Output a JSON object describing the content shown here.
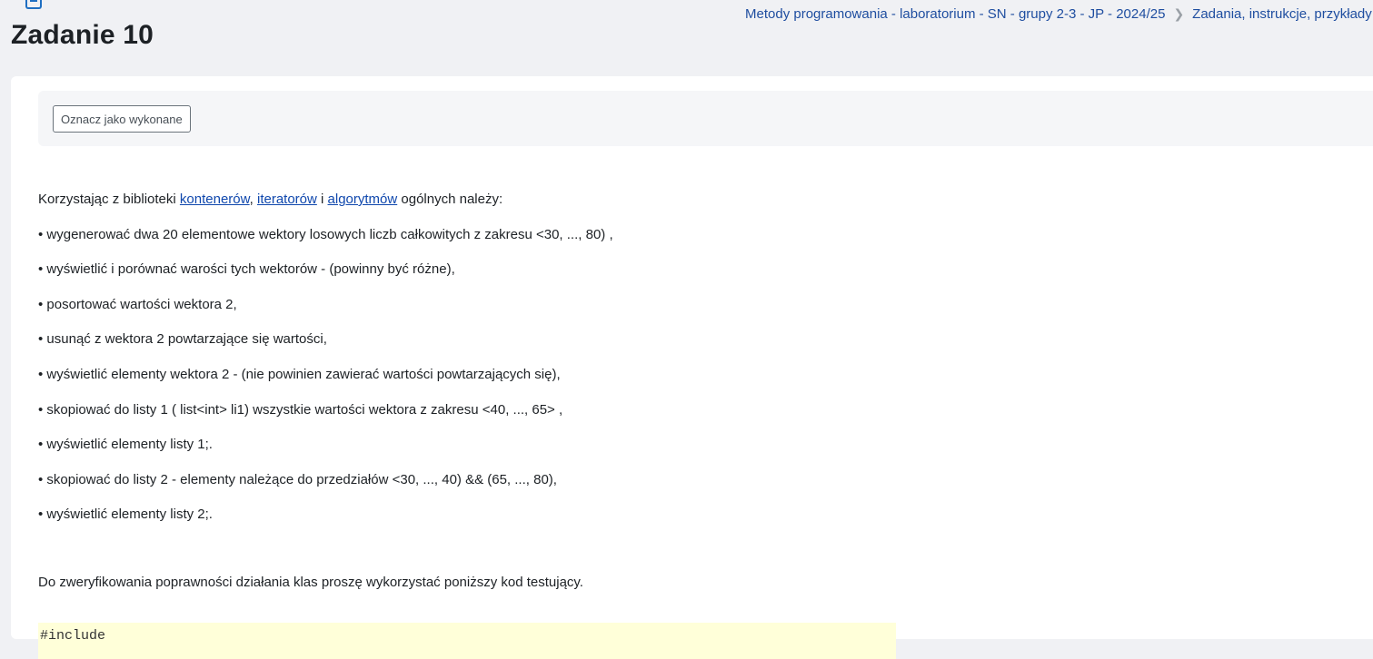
{
  "header": {
    "title": "Zadanie 10",
    "breadcrumb": [
      "Metody programowania - laboratorium - SN - grupy 2-3 - JP - 2024/25",
      "Zadania, instrukcje, przykłady"
    ]
  },
  "completion": {
    "button_label": "Oznacz jako wykonane"
  },
  "task": {
    "intro_prefix": "Korzystając z biblioteki ",
    "link_containers": "kontenerów",
    "comma": ", ",
    "link_iterators": "iteratorów",
    "and": " i ",
    "link_algorithms": "algorytmów",
    "intro_suffix": " ogólnych należy:",
    "items": [
      "• wygenerować dwa 20 elementowe wektory losowych liczb całkowitych z zakresu <30, ..., 80) ,",
      "• wyświetlić i porównać warości tych wektorów - (powinny być różne),",
      "• posortować wartości wektora 2,",
      "• usunąć z wektora 2 powtarzające się wartości,",
      "• wyświetlić elementy wektora 2 - (nie powinien zawierać wartości powtarzających się),",
      "• skopiować  do listy 1 ( list<int> li1)  wszystkie wartości wektora z zakresu <40, ..., 65> ,",
      "• wyświetlić elementy listy 1;.",
      "• skopiować  do listy 2 - elementy należące do przedziałów <30, ..., 40) && (65, ..., 80),",
      "• wyświetlić elementy listy 2;."
    ],
    "verify_text": "Do zweryfikowania poprawności działania klas proszę wykorzystać poniższy kod testujący.",
    "code_first_line": "#include"
  },
  "icons": {
    "page": "page-icon",
    "breadcrumb_separator": "chevron-right-icon"
  },
  "colors": {
    "background": "#f0f1f4",
    "link": "#0f47ad",
    "code_background": "#ffffd9"
  }
}
